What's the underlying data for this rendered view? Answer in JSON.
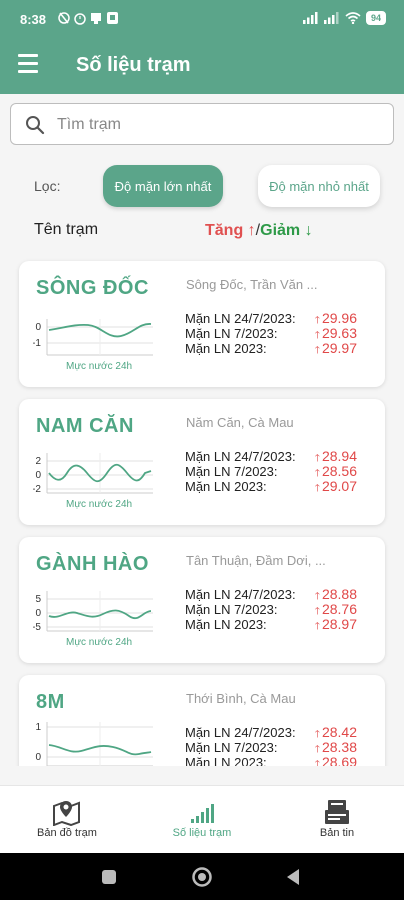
{
  "status": {
    "time": "8:38",
    "battery": "94"
  },
  "header": {
    "title": "Số liệu trạm"
  },
  "search": {
    "placeholder": "Tìm trạm"
  },
  "filter": {
    "label": "Lọc:",
    "max_label": "Độ mặn lớn nhất",
    "min_label": "Độ mặn nhỏ nhất"
  },
  "list_header": {
    "name_label": "Tên trạm",
    "up_label": "Tăng ↑",
    "sep": "/",
    "down_label": "Giảm ↓"
  },
  "stations": [
    {
      "name": "SÔNG ĐỐC",
      "location": "Sông Đốc, Trần Văn ...",
      "chart_caption": "Mực nước 24h",
      "y_ticks": [
        "0",
        "-1"
      ],
      "metrics": [
        {
          "label": "Mặn LN 24/7/2023:",
          "value": "29.96"
        },
        {
          "label": "Mặn LN 7/2023:",
          "value": "29.63"
        },
        {
          "label": "Mặn LN 2023:",
          "value": "29.97"
        }
      ]
    },
    {
      "name": "NAM CĂN",
      "location": "Năm Căn, Cà Mau",
      "chart_caption": "Mực nước 24h",
      "y_ticks": [
        "2",
        "0",
        "-2"
      ],
      "metrics": [
        {
          "label": "Mặn LN 24/7/2023:",
          "value": "28.94"
        },
        {
          "label": "Mặn LN 7/2023:",
          "value": "28.56"
        },
        {
          "label": "Mặn LN 2023:",
          "value": "29.07"
        }
      ]
    },
    {
      "name": "GÀNH HÀO",
      "location": "Tân Thuận, Đầm Dơi, ...",
      "chart_caption": "Mực nước 24h",
      "y_ticks": [
        "5",
        "0",
        "-5"
      ],
      "metrics": [
        {
          "label": "Mặn LN 24/7/2023:",
          "value": "28.88"
        },
        {
          "label": "Mặn LN 7/2023:",
          "value": "28.76"
        },
        {
          "label": "Mặn LN 2023:",
          "value": "28.97"
        }
      ]
    },
    {
      "name": "8M",
      "location": "Thới Bình, Cà Mau",
      "chart_caption": "",
      "y_ticks": [
        "1",
        "0"
      ],
      "metrics": [
        {
          "label": "Mặn LN 24/7/2023:",
          "value": "28.42"
        },
        {
          "label": "Mặn LN 7/2023:",
          "value": "28.38"
        },
        {
          "label": "Mặn LN 2023:",
          "value": "28.69"
        }
      ]
    }
  ],
  "bottom_nav": [
    {
      "label": "Bản đồ trạm",
      "icon": "map-marker-icon"
    },
    {
      "label": "Số liệu trạm",
      "icon": "signal-bars-icon"
    },
    {
      "label": "Bản tin",
      "icon": "newspaper-icon"
    }
  ],
  "colors": {
    "primary": "#5ba58a",
    "increase": "#e05050",
    "decrease": "#2e9a48"
  }
}
